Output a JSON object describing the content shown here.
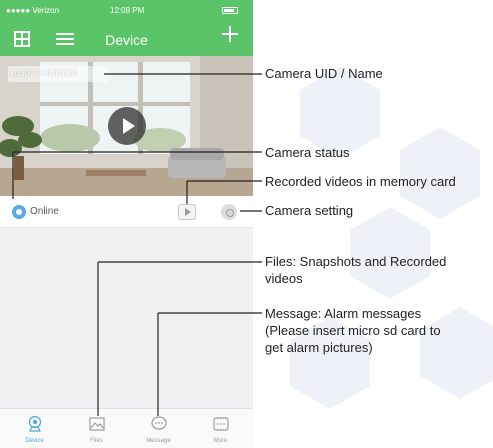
{
  "status_bar": {
    "carrier": "●●●●● Verizon",
    "time": "12:08 PM"
  },
  "nav": {
    "title": "Device",
    "icons": [
      "grid-icon",
      "list-icon",
      "plus-icon"
    ]
  },
  "camera": {
    "uid": "AI0079-HUDICH",
    "status": "Online",
    "icons": [
      "play-icon",
      "record-icon",
      "settings-icon"
    ]
  },
  "tabs": [
    {
      "label": "Device",
      "icon": "camera-icon",
      "active": true
    },
    {
      "label": "Files",
      "icon": "image-icon",
      "active": false
    },
    {
      "label": "Message",
      "icon": "message-icon",
      "active": false
    },
    {
      "label": "More",
      "icon": "more-icon",
      "active": false
    }
  ],
  "callouts": {
    "uid": "Camera UID / Name",
    "status": "Camera status",
    "recorded": "Recorded videos in memory card",
    "setting": "Camera setting",
    "files_line1": "Files: Snapshots and Recorded",
    "files_line2": "videos",
    "message_line1": "Message: Alarm messages",
    "message_line2": "(Please insert micro sd card to",
    "message_line3": "get alarm pictures)"
  },
  "colors": {
    "header_green": "#5cc468",
    "active_tab_blue": "#4aa8e0"
  }
}
